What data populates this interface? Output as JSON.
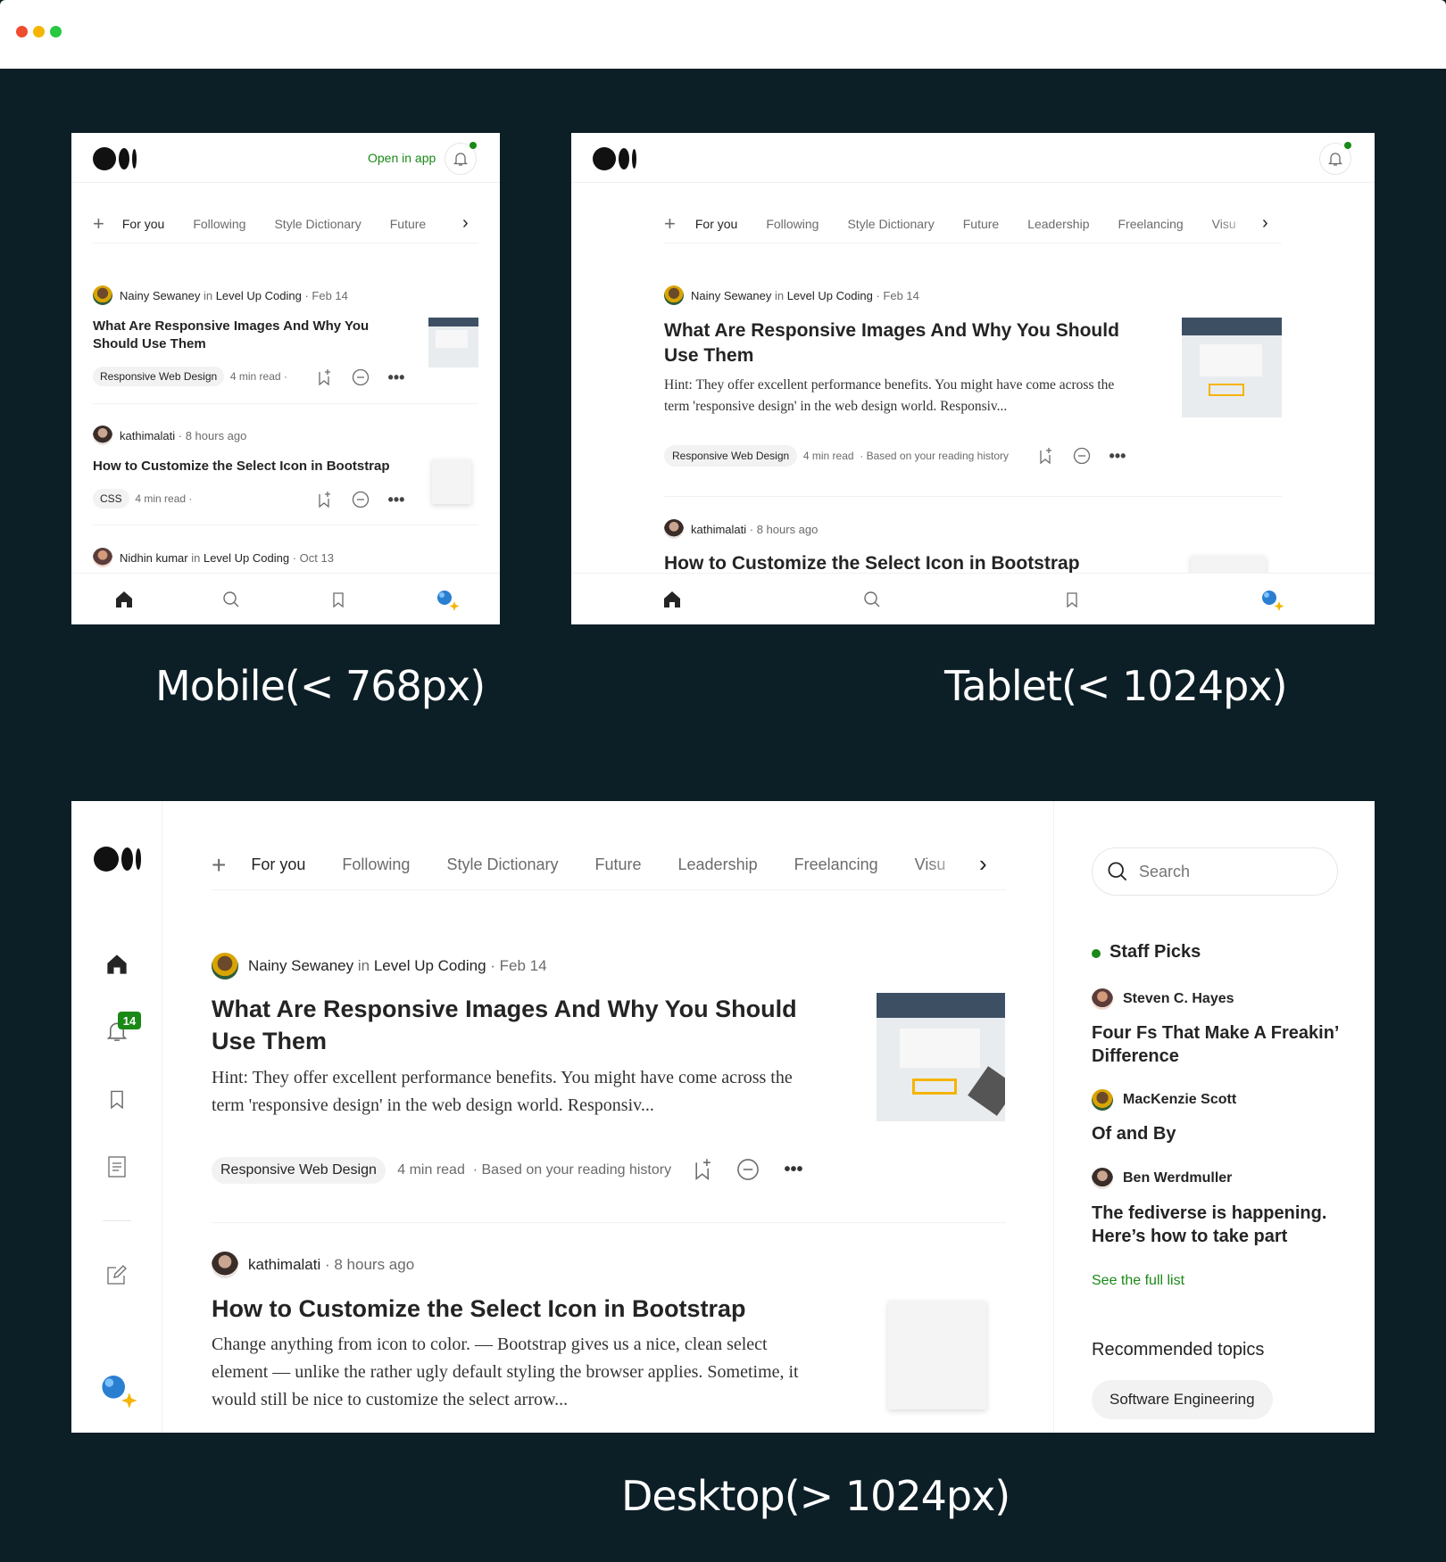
{
  "mobile": {
    "open_in_app": "Open in app",
    "tabs": [
      "For you",
      "Following",
      "Style Dictionary",
      "Future"
    ],
    "articles": [
      {
        "author": "Nainy Sewaney",
        "in": "in",
        "publication": "Level Up Coding",
        "date": "· Feb 14",
        "title": "What Are Responsive Images And Why You Should Use Them",
        "tag": "Responsive Web Design",
        "read": "4 min read",
        "dot": "·"
      },
      {
        "author": "kathimalati",
        "date": "· 8 hours ago",
        "title": "How to Customize the Select Icon in Bootstrap",
        "tag": "CSS",
        "read": "4 min read",
        "dot": "·"
      },
      {
        "author": "Nidhin kumar",
        "in": "in",
        "publication": "Level Up Coding",
        "date": "· Oct 13"
      }
    ]
  },
  "tablet": {
    "tabs": [
      "For you",
      "Following",
      "Style Dictionary",
      "Future",
      "Leadership",
      "Freelancing",
      "Visu"
    ],
    "articles": [
      {
        "author": "Nainy Sewaney",
        "in": "in",
        "publication": "Level Up Coding",
        "date": "· Feb 14",
        "title": "What Are Responsive Images And Why You Should Use Them",
        "snippet": "Hint: They offer excellent performance benefits. You might have come across the term 'responsive design' in the web design world. Responsiv...",
        "tag": "Responsive Web Design",
        "read": "4 min read",
        "reason": "· Based on your reading history"
      },
      {
        "author": "kathimalati",
        "date": "· 8 hours ago",
        "title": "How to Customize the Select Icon in Bootstrap"
      }
    ]
  },
  "desktop": {
    "tabs": [
      "For you",
      "Following",
      "Style Dictionary",
      "Future",
      "Leadership",
      "Freelancing",
      "Visu"
    ],
    "notification_count": "14",
    "articles": [
      {
        "author": "Nainy Sewaney",
        "in": "in",
        "publication": "Level Up Coding",
        "date": "· Feb 14",
        "title": "What Are Responsive Images And Why You Should Use Them",
        "snippet": "Hint: They offer excellent performance benefits. You might have come across the term 'responsive design' in the web design world. Responsiv...",
        "tag": "Responsive Web Design",
        "read": "4 min read",
        "reason": "· Based on your reading history"
      },
      {
        "author": "kathimalati",
        "date": "· 8 hours ago",
        "title": "How to Customize the Select Icon in Bootstrap",
        "snippet": "Change anything from icon to color. — Bootstrap gives us a nice, clean select element — unlike the rather ugly default styling the browser applies. Sometime, it would still be nice to customize the select arrow..."
      }
    ],
    "sidebar": {
      "search_placeholder": "Search",
      "staff_picks_title": "Staff Picks",
      "picks": [
        {
          "author": "Steven C. Hayes",
          "title": "Four Fs That Make A Freakin’ Difference"
        },
        {
          "author": "MacKenzie Scott",
          "title": "Of and By"
        },
        {
          "author": "Ben Werdmuller",
          "title": "The fediverse is happening. Here’s how to take part"
        }
      ],
      "see_full_list": "See the full list",
      "recommended_topics": "Recommended topics",
      "topics": [
        "Software Engineering"
      ]
    }
  },
  "labels": {
    "mobile": "Mobile(< 768px)",
    "tablet": "Tablet(< 1024px)",
    "desktop": "Desktop(> 1024px)"
  },
  "colors": {
    "background": "#0c1e26",
    "accent": "#1a8917",
    "dot_red": "#ee4d2e",
    "dot_yellow": "#f5b400",
    "dot_green": "#28c840"
  }
}
